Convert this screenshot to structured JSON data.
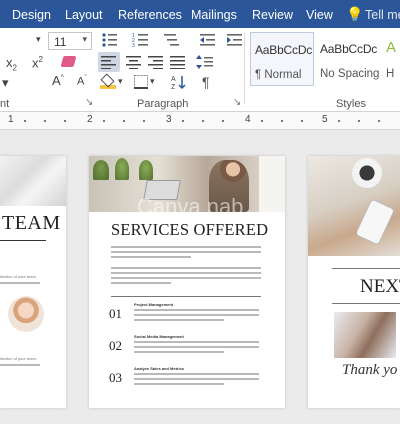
{
  "menu": {
    "tabs": [
      "Design",
      "Layout",
      "References",
      "Mailings",
      "Review",
      "View"
    ],
    "tell_me": "Tell me"
  },
  "ribbon": {
    "font_size": "11",
    "groups": {
      "paragraph": "Paragraph",
      "styles": "Styles"
    },
    "styles": [
      {
        "sample": "AaBbCcDc",
        "name": "¶ Normal"
      },
      {
        "sample": "AaBbCcDc",
        "name": "No Spacing"
      },
      {
        "sample": "A",
        "name": "H"
      }
    ]
  },
  "ruler": {
    "numbers": [
      "1",
      "2",
      "3",
      "4",
      "5"
    ]
  },
  "watermark": "Canva nab",
  "left_page": {
    "heading": "TEAM",
    "text_block": "llection of your team."
  },
  "middle_page": {
    "title": "SERVICES OFFERED",
    "services": [
      {
        "num": "01",
        "title": "Project Management"
      },
      {
        "num": "02",
        "title": "Social Media Management"
      },
      {
        "num": "03",
        "title": "Analyze Sales and Metrics"
      }
    ]
  },
  "right_page": {
    "heading": "NEXT",
    "signoff": "Thank yo"
  }
}
